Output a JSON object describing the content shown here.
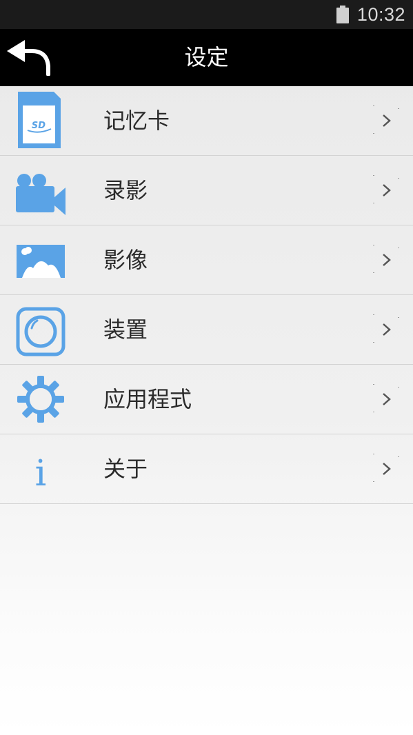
{
  "status_bar": {
    "time": "10:32",
    "battery_icon": "battery-icon"
  },
  "app_bar": {
    "title": "设定",
    "back_icon": "back-arrow-icon"
  },
  "menu": {
    "items": [
      {
        "label": "记忆卡",
        "icon": "sd-card-icon"
      },
      {
        "label": "录影",
        "icon": "video-camera-icon"
      },
      {
        "label": "影像",
        "icon": "image-icon"
      },
      {
        "label": "装置",
        "icon": "device-icon"
      },
      {
        "label": "应用程式",
        "icon": "gear-icon"
      },
      {
        "label": "关于",
        "icon": "info-icon"
      }
    ]
  },
  "colors": {
    "accent": "#5aa3e6",
    "status_bar_bg": "#1b1b1b",
    "app_bar_bg": "#000000"
  }
}
